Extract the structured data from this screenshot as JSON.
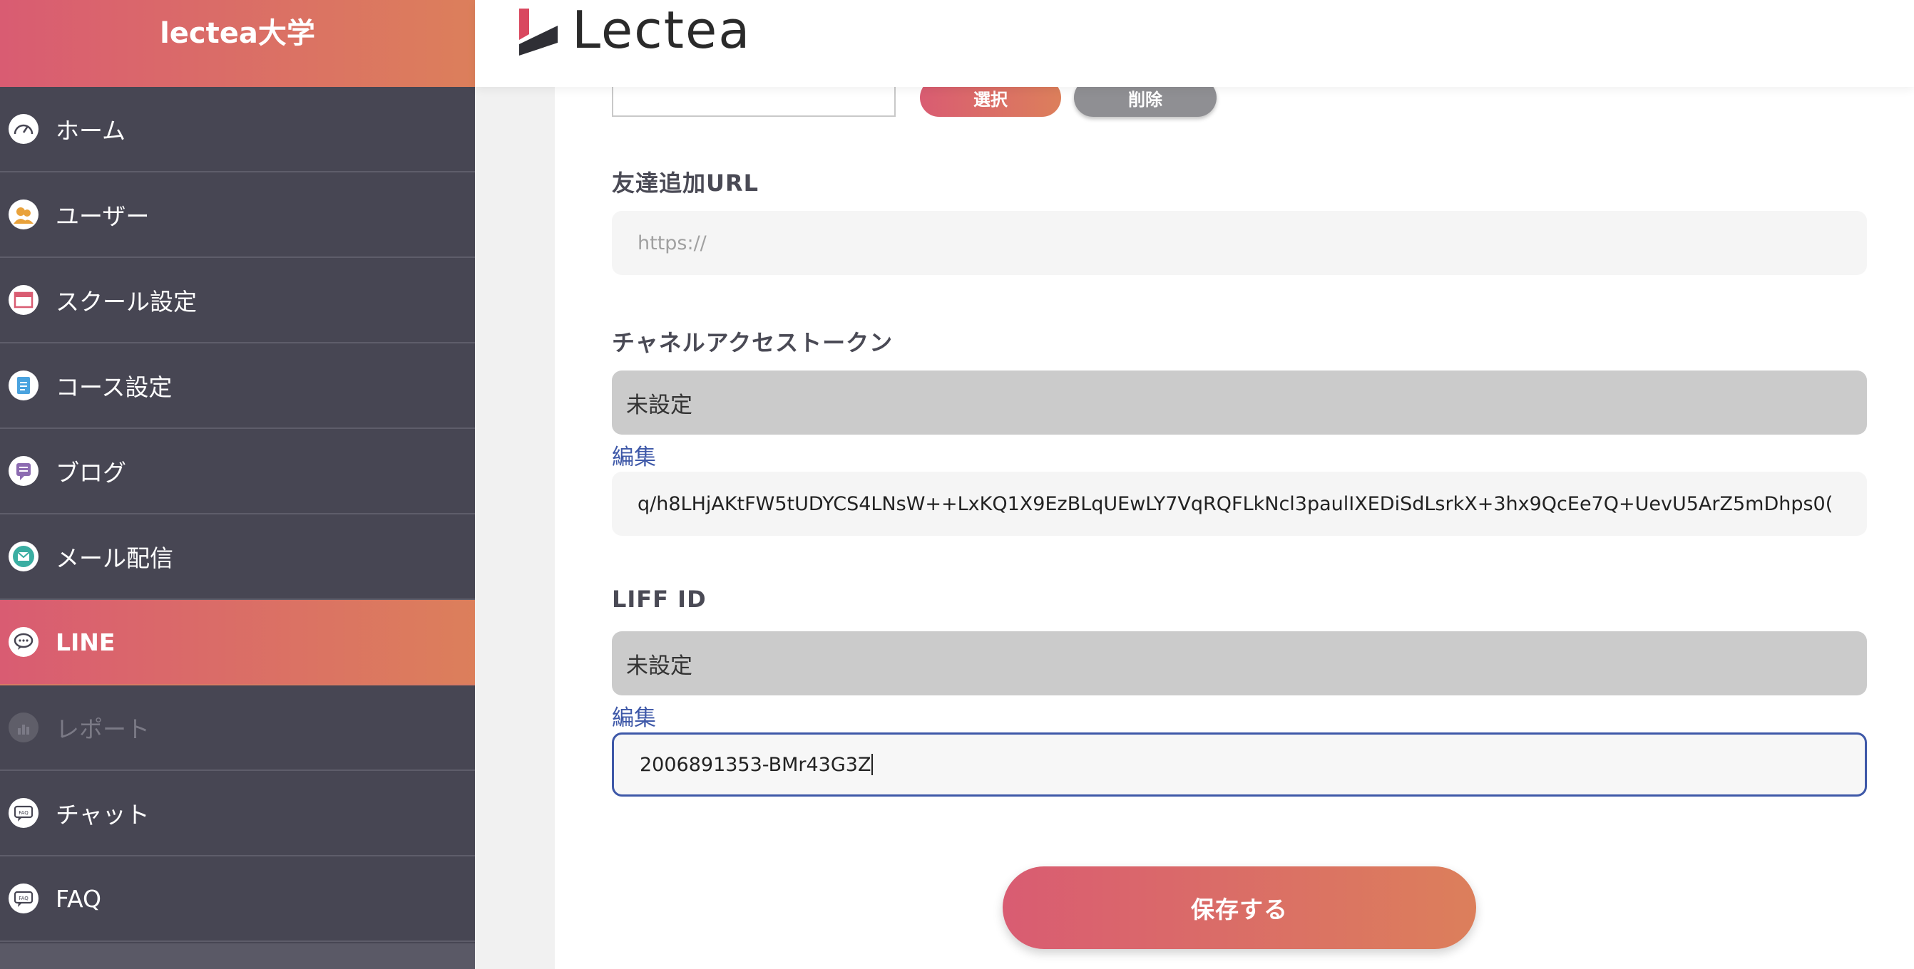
{
  "brand": {
    "title": "lectea大学",
    "logo_text": "Lectea"
  },
  "sidebar": {
    "items": [
      {
        "label": "ホーム",
        "icon": "speedometer-icon",
        "state": "normal"
      },
      {
        "label": "ユーザー",
        "icon": "users-icon",
        "state": "normal"
      },
      {
        "label": "スクール設定",
        "icon": "window-icon",
        "state": "normal"
      },
      {
        "label": "コース設定",
        "icon": "document-icon",
        "state": "normal"
      },
      {
        "label": "ブログ",
        "icon": "blog-icon",
        "state": "normal"
      },
      {
        "label": "メール配信",
        "icon": "mail-icon",
        "state": "normal"
      },
      {
        "label": "LINE",
        "icon": "chat-bubble-icon",
        "state": "active"
      },
      {
        "label": "レポート",
        "icon": "report-chart-icon",
        "state": "disabled"
      },
      {
        "label": "チャット",
        "icon": "faq-chat-icon",
        "state": "normal"
      },
      {
        "label": "FAQ",
        "icon": "faq-icon",
        "state": "normal"
      }
    ]
  },
  "form": {
    "image_buttons": {
      "select": "選択",
      "delete": "削除"
    },
    "friend_url": {
      "label": "友達追加URL",
      "placeholder": "https://"
    },
    "channel_token": {
      "label": "チャネルアクセストークン",
      "current": "未設定",
      "edit": "編集",
      "value": "q/h8LHjAKtFW5tUDYCS4LNsW++LxKQ1X9EzBLqUEwLY7VqRQFLkNcl3paulIXEDiSdLsrkX+3hx9QcEe7Q+UevU5ArZ5mDhps0("
    },
    "liff_id": {
      "label": "LIFF ID",
      "current": "未設定",
      "edit": "編集",
      "value": "2006891353-BMr43G3Z"
    },
    "save": "保存する"
  },
  "colors": {
    "accent_start": "#d95c72",
    "accent_end": "#dc7f5b",
    "sidebar_bg": "#474653",
    "link": "#3e58a8"
  }
}
